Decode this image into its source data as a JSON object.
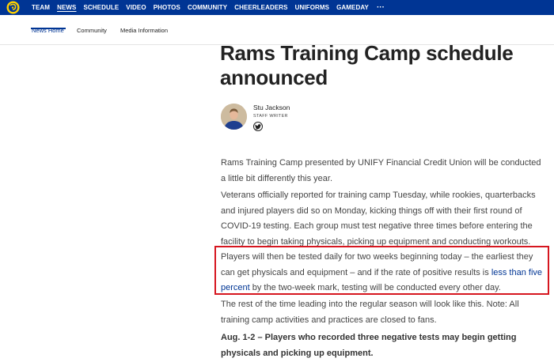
{
  "topnav": {
    "items": [
      "TEAM",
      "NEWS",
      "SCHEDULE",
      "VIDEO",
      "PHOTOS",
      "COMMUNITY",
      "CHEERLEADERS",
      "UNIFORMS",
      "GAMEDAY"
    ],
    "more_label": "···",
    "active_item": "NEWS",
    "background_color": "#003594"
  },
  "subnav": {
    "items": [
      "News Home",
      "Community",
      "Media Information"
    ],
    "active_item": "News Home"
  },
  "article": {
    "title": "Rams Training Camp schedule announced",
    "author": {
      "name": "Stu Jackson",
      "role": "STAFF WRITER",
      "social_icon": "twitter-icon"
    },
    "paragraphs": [
      "Rams Training Camp presented by UNIFY Financial Credit Union will be conducted a little bit differently this year.",
      "Veterans officially reported for training camp Tuesday, while rookies, quarterbacks and injured players did so on Monday, kicking things off with their first round of COVID-19 testing. Each group must test negative three times before entering the facility to begin taking physicals, picking up equipment and conducting workouts."
    ],
    "highlighted_paragraph": {
      "before_link": "Players will then be tested daily for two weeks beginning today – the earliest they can get physicals and equipment – and if the rate of positive results is ",
      "link_text": "less than five percent",
      "after_link": " by the two-week mark, testing will be conducted every other day.",
      "border_color": "#d6161f"
    },
    "paragraph_after": "The rest of the time leading into the regular season will look like this. Note: All training camp activities and practices are closed to fans.",
    "bold_paragraph": "Aug. 1-2 – Players who recorded three negative tests may begin getting physicals and picking up equipment."
  }
}
